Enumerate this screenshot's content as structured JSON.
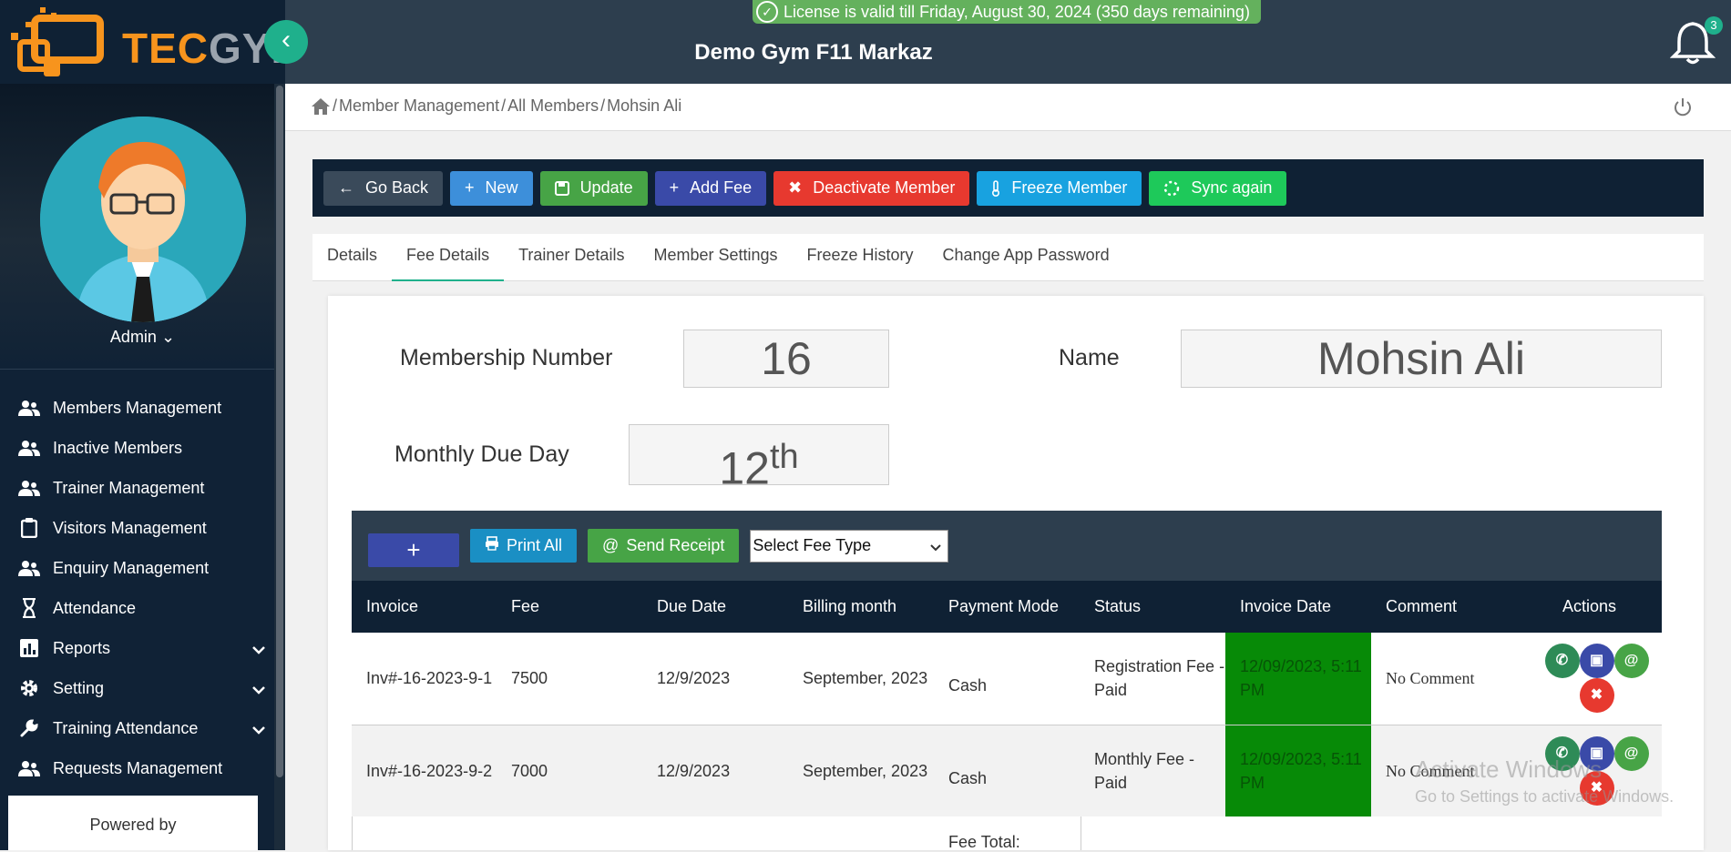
{
  "brand": {
    "tec": "TEC",
    "gym": "GYM"
  },
  "license": "License is valid till Friday, August 30, 2024 (350 days remaining)",
  "gym_name": "Demo Gym F11 Markaz",
  "notifications": {
    "count": "3"
  },
  "admin": {
    "label": "Admin"
  },
  "nav": [
    {
      "label": "Members Management",
      "icon": "users-icon"
    },
    {
      "label": "Inactive Members",
      "icon": "users-icon"
    },
    {
      "label": "Trainer Management",
      "icon": "users-icon"
    },
    {
      "label": "Visitors Management",
      "icon": "clipboard-icon"
    },
    {
      "label": "Enquiry Management",
      "icon": "users-icon"
    },
    {
      "label": "Attendance",
      "icon": "hourglass-icon"
    },
    {
      "label": "Reports",
      "icon": "chart-icon",
      "expandable": true
    },
    {
      "label": "Setting",
      "icon": "gear-icon",
      "expandable": true
    },
    {
      "label": "Training Attendance",
      "icon": "wrench-icon",
      "expandable": true
    },
    {
      "label": "Requests Management",
      "icon": "users-icon"
    }
  ],
  "powered_by": "Powered by",
  "breadcrumb": [
    "Member Management",
    "All Members",
    "Mohsin Ali"
  ],
  "toolbar": {
    "go_back": "Go Back",
    "new": "New",
    "update": "Update",
    "add_fee": "Add Fee",
    "deactivate": "Deactivate Member",
    "freeze": "Freeze Member",
    "sync": "Sync again"
  },
  "tabs": [
    "Details",
    "Fee Details",
    "Trainer Details",
    "Member Settings",
    "Freeze History",
    "Change App Password"
  ],
  "active_tab": "Fee Details",
  "member": {
    "membership_label": "Membership Number",
    "membership_value": "16",
    "name_label": "Name",
    "name_value": "Mohsin Ali",
    "due_label": "Monthly Due Day",
    "due_value": "12",
    "due_suffix": "th"
  },
  "fee_toolbar": {
    "add": "+",
    "print_all": "Print All",
    "send_receipt": "Send Receipt",
    "select_placeholder": "Select Fee Type"
  },
  "fee_table": {
    "columns": [
      "Invoice",
      "Fee",
      "Due Date",
      "Billing month",
      "Payment Mode",
      "Status",
      "Invoice Date",
      "Comment",
      "Actions"
    ],
    "rows": [
      {
        "invoice": "Inv#-16-2023-9-1",
        "fee": "7500",
        "due_date": "12/9/2023",
        "billing_month": "September, 2023",
        "payment_mode": "Cash",
        "status": "Registration Fee - Paid",
        "invoice_date": "12/09/2023, 5:11 PM",
        "comment": "No Comment"
      },
      {
        "invoice": "Inv#-16-2023-9-2",
        "fee": "7000",
        "due_date": "12/9/2023",
        "billing_month": "September, 2023",
        "payment_mode": "Cash",
        "status": "Monthly Fee - Paid",
        "invoice_date": "12/09/2023, 5:11 PM",
        "comment": "No Comment"
      }
    ],
    "total_label": "Fee Total:"
  },
  "watermark": {
    "line1": "Activate Windows",
    "line2": "Go to Settings to activate Windows."
  },
  "colors": {
    "sidebar": "#102236",
    "accent": "#1fb08c",
    "topbar": "#2d3e4e",
    "paid_date": "#078a07"
  }
}
